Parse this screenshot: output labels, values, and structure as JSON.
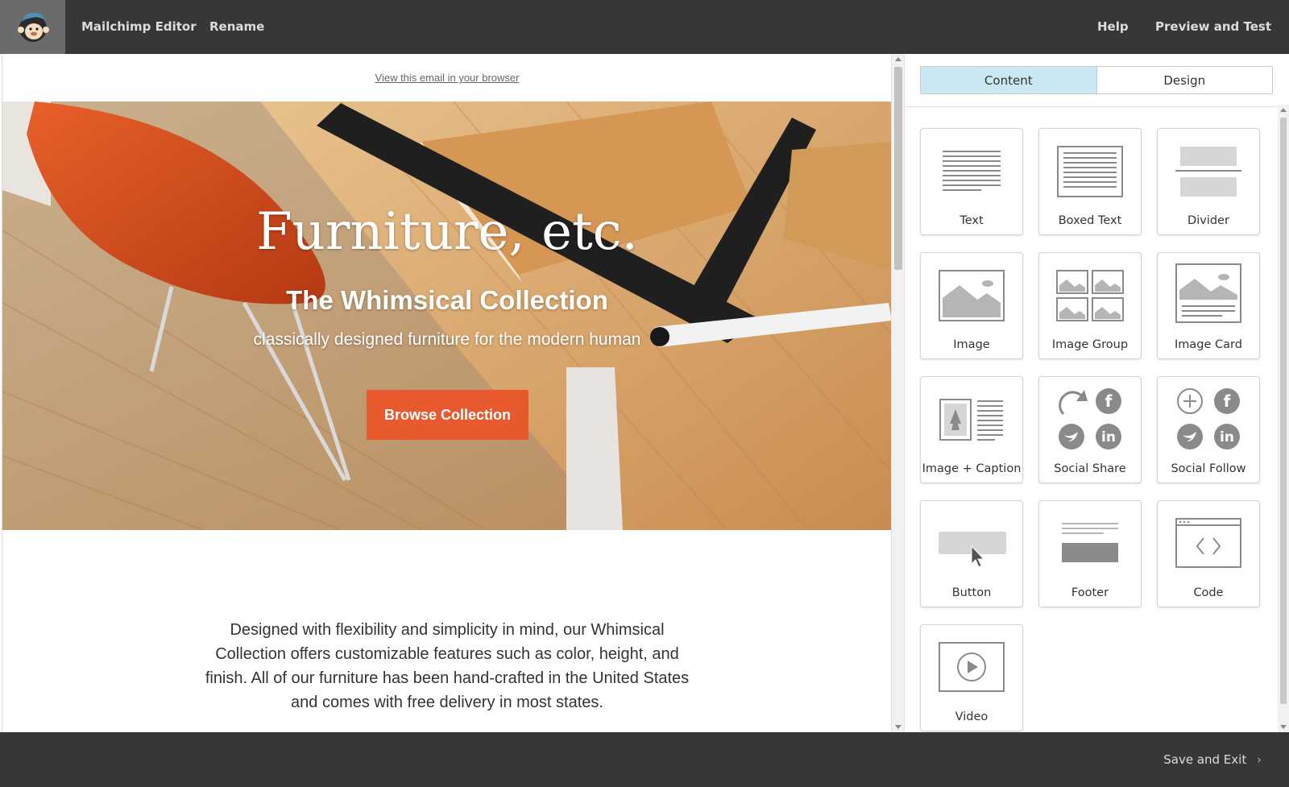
{
  "topbar": {
    "app_title": "Mailchimp Editor",
    "rename_label": "Rename",
    "help_label": "Help",
    "preview_label": "Preview and Test"
  },
  "email": {
    "view_in_browser": "View this email in your browser",
    "hero_title": "Furniture, etc.",
    "hero_subtitle": "The Whimsical Collection",
    "hero_tagline": "classically designed furniture for the modern human",
    "button_label": "Browse Collection",
    "body_text": "Designed with flexibility and simplicity in mind, our Whimsical Collection offers customizable features such as color, height, and finish. All of our furniture has been hand-crafted in the United States and comes with free delivery in most states."
  },
  "panel": {
    "tabs": [
      {
        "label": "Content",
        "active": true
      },
      {
        "label": "Design",
        "active": false
      }
    ],
    "blocks": [
      {
        "label": "Text",
        "icon": "text-lines-icon"
      },
      {
        "label": "Boxed Text",
        "icon": "boxed-text-icon"
      },
      {
        "label": "Divider",
        "icon": "divider-icon"
      },
      {
        "label": "Image",
        "icon": "image-icon"
      },
      {
        "label": "Image Group",
        "icon": "image-group-icon"
      },
      {
        "label": "Image Card",
        "icon": "image-card-icon"
      },
      {
        "label": "Image + Caption",
        "icon": "image-caption-icon"
      },
      {
        "label": "Social Share",
        "icon": "social-share-icon"
      },
      {
        "label": "Social Follow",
        "icon": "social-follow-icon"
      },
      {
        "label": "Button",
        "icon": "button-block-icon"
      },
      {
        "label": "Footer",
        "icon": "footer-icon"
      },
      {
        "label": "Code",
        "icon": "code-icon"
      },
      {
        "label": "Video",
        "icon": "video-icon"
      }
    ]
  },
  "footer": {
    "save_exit_label": "Save and Exit"
  },
  "colors": {
    "topbar_bg": "#373737",
    "accent_button": "#e85a2e",
    "active_tab": "#c9e8f2"
  }
}
